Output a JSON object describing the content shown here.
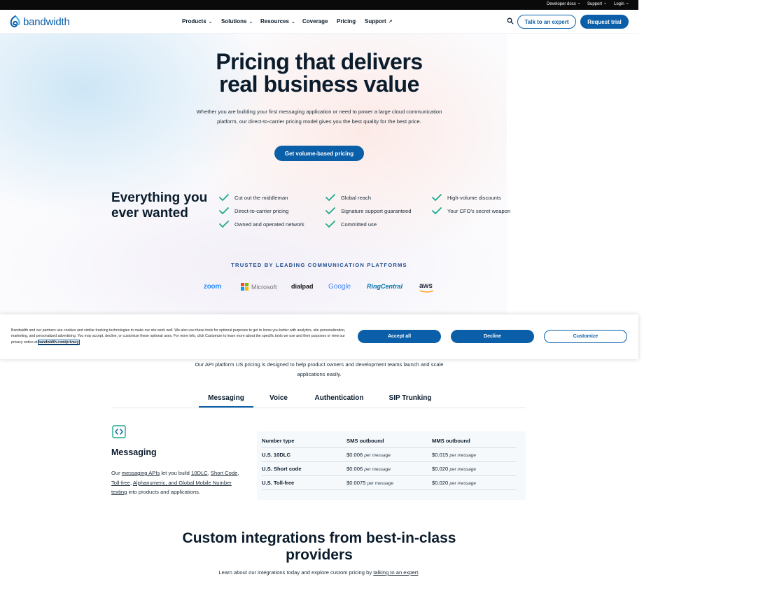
{
  "utility_bar": {
    "developer_docs": "Developer docs",
    "support": "Support",
    "login": "Login"
  },
  "brand": {
    "name": "bandwidth",
    "color": "#0b5fa8"
  },
  "nav": {
    "products": "Products",
    "solutions": "Solutions",
    "resources": "Resources",
    "coverage": "Coverage",
    "pricing": "Pricing",
    "support": "Support",
    "talk_to_expert": "Talk to an expert",
    "request_trial": "Request trial"
  },
  "hero": {
    "title_line1": "Pricing that delivers",
    "title_line2": "real business value",
    "subtitle": "Whether you are building your first messaging application or need to power a large cloud communication platform, our direct-to-carrier pricing model gives you the best quality for the best price.",
    "cta": "Get volume-based pricing"
  },
  "features": {
    "heading": "Everything you ever wanted",
    "items": [
      "Cut out the middleman",
      "Direct-to-carrier pricing",
      "Owned and operated network",
      "Global reach",
      "Signature support guaranteed",
      "Committed use",
      "High-volume discounts",
      "Your CFO's secret weapon"
    ],
    "check_color": "#1fa98c"
  },
  "trusted": {
    "label": "TRUSTED BY LEADING COMMUNICATION PLATFORMS",
    "logos": [
      "zoom",
      "Microsoft",
      "dialpad",
      "Google",
      "RingCentral",
      "aws"
    ]
  },
  "cookie": {
    "text": "Bandwidth and our partners use cookies and similar tracking technologies to make our site work well. We also use these tools for optional purposes to get to know you better with analytics, site personalization, marketing, and personalized advertising. You may accept, decline, or customize these optional uses. For more info, click Customize to learn more about the specific tools we use and their purposes or view our privacy notice at",
    "link": "bandwidth.com/privacy",
    "accept": "Accept all",
    "decline": "Decline",
    "customize": "Customize"
  },
  "pricing": {
    "subtitle": "Our API platform US pricing is designed to help product owners and development teams launch and scale applications easily.",
    "tabs": [
      "Messaging",
      "Voice",
      "Authentication",
      "SIP Trunking"
    ],
    "active_tab": "Messaging"
  },
  "messaging": {
    "heading": "Messaging",
    "body": {
      "our": "Our",
      "messaging_apis": "messaging APIs",
      "let_you_build": "let you build",
      "tendlc": "10DLC",
      "comma1": ",",
      "short_code": "Short Code",
      "comma2": ",",
      "toll_free": "Toll-free",
      "comma3": ",",
      "alphanumeric": "Alphanumeric, and Global Mobile Number texting",
      "tail": "into products and applications."
    },
    "table": {
      "headers": [
        "Number type",
        "SMS outbound",
        "MMS outbound"
      ],
      "per_label": "per message",
      "rows": [
        {
          "type": "U.S. 10DLC",
          "sms": "$0.006",
          "mms": "$0.015"
        },
        {
          "type": "U.S. Short code",
          "sms": "$0.006",
          "mms": "$0.020"
        },
        {
          "type": "U.S. Toll-free",
          "sms": "$0.0075",
          "mms": "$0.020"
        }
      ]
    }
  },
  "custom": {
    "heading_line1": "Custom integrations from best-in-class",
    "heading_line2": "providers",
    "sub_pre": "Learn about our integrations today and explore custom pricing by",
    "sub_link": "talking to an expert",
    "sub_post": "."
  }
}
